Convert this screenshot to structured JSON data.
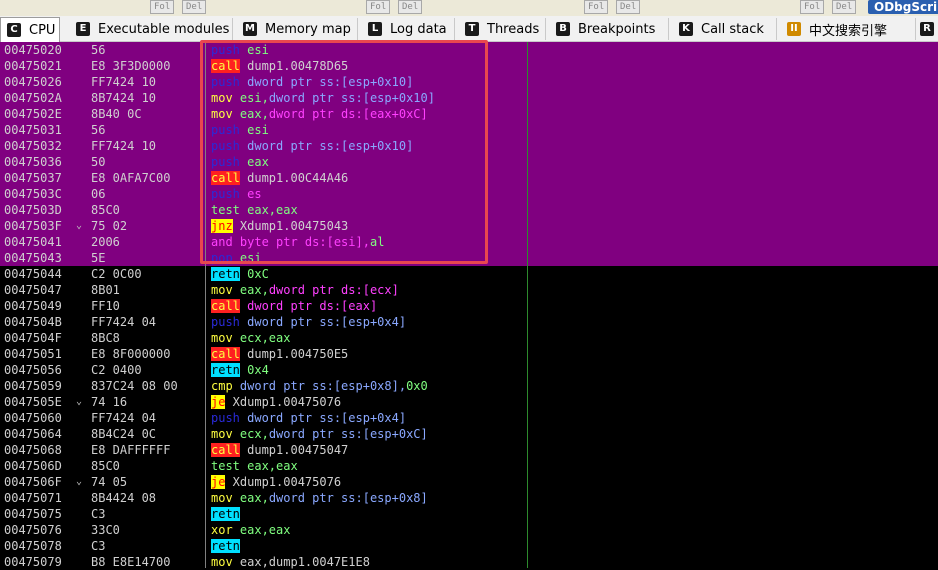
{
  "topstrip": {
    "buttons": [
      "Fol",
      "Del",
      "Fol",
      "Del",
      "Fol",
      "Del",
      "Fol",
      "Del"
    ],
    "plugin_button": "ODbgScri"
  },
  "tabs": [
    {
      "label": "CPU",
      "icon": "C",
      "color": "#1a1a1a"
    },
    {
      "label": "Executable modules",
      "icon": "E",
      "color": "#1a1a1a"
    },
    {
      "label": "Memory map",
      "icon": "M",
      "color": "#1a1a1a"
    },
    {
      "label": "Log data",
      "icon": "L",
      "color": "#1a1a1a"
    },
    {
      "label": "Threads",
      "icon": "T",
      "color": "#1a1a1a"
    },
    {
      "label": "Breakpoints",
      "icon": "B",
      "color": "#1a1a1a"
    },
    {
      "label": "Call stack",
      "icon": "K",
      "color": "#1a1a1a"
    },
    {
      "label": "中文搜索引擎",
      "icon": "II",
      "color": "#d08a00"
    },
    {
      "label": "R",
      "icon": "",
      "color": ""
    }
  ],
  "rows": [
    {
      "addr": "00475020",
      "mark": "",
      "hex": "56",
      "hl": true,
      "asm": [
        [
          "push",
          "kw-push"
        ],
        [
          " esi",
          "reg"
        ]
      ]
    },
    {
      "addr": "00475021",
      "mark": "",
      "hex": "E8 3F3D0000",
      "hl": true,
      "asm": [
        [
          "call",
          "kw-call"
        ],
        [
          " dump1.00478D65",
          "sym"
        ]
      ]
    },
    {
      "addr": "00475026",
      "mark": "",
      "hex": "FF7424 10",
      "hl": true,
      "asm": [
        [
          "push",
          "kw-push"
        ],
        [
          " dword ptr ss:[esp+0x10]",
          "mem"
        ]
      ]
    },
    {
      "addr": "0047502A",
      "mark": "",
      "hex": "8B7424 10",
      "hl": true,
      "asm": [
        [
          "mov",
          "kw-mov"
        ],
        [
          " esi,",
          "reg"
        ],
        [
          "dword ptr ss:[esp+0x10]",
          "mem"
        ]
      ]
    },
    {
      "addr": "0047502E",
      "mark": "",
      "hex": "8B40 0C",
      "hl": true,
      "asm": [
        [
          "mov",
          "kw-mov"
        ],
        [
          " eax,",
          "reg"
        ],
        [
          "dword ptr ds:[eax+0xC]",
          "memA"
        ]
      ]
    },
    {
      "addr": "00475031",
      "mark": "",
      "hex": "56",
      "hl": true,
      "asm": [
        [
          "push",
          "kw-push"
        ],
        [
          " esi",
          "reg"
        ]
      ]
    },
    {
      "addr": "00475032",
      "mark": "",
      "hex": "FF7424 10",
      "hl": true,
      "asm": [
        [
          "push",
          "kw-push"
        ],
        [
          " dword ptr ss:[esp+0x10]",
          "mem"
        ]
      ]
    },
    {
      "addr": "00475036",
      "mark": "",
      "hex": "50",
      "hl": true,
      "asm": [
        [
          "push",
          "kw-push"
        ],
        [
          " eax",
          "reg"
        ]
      ]
    },
    {
      "addr": "00475037",
      "mark": "",
      "hex": "E8 0AFA7C00",
      "hl": true,
      "asm": [
        [
          "call",
          "kw-call"
        ],
        [
          " dump1.00C44A46",
          "sym"
        ]
      ]
    },
    {
      "addr": "0047503C",
      "mark": "",
      "hex": "06",
      "hl": true,
      "asm": [
        [
          "push",
          "kw-push"
        ],
        [
          " es",
          "seg"
        ]
      ]
    },
    {
      "addr": "0047503D",
      "mark": "",
      "hex": "85C0",
      "hl": true,
      "asm": [
        [
          "test",
          "kw-test"
        ],
        [
          " eax,eax",
          "reg"
        ]
      ]
    },
    {
      "addr": "0047503F",
      "mark": "⌄",
      "hex": "75 02",
      "hl": true,
      "asm": [
        [
          "jnz",
          "kw-jcc"
        ],
        [
          " Xdump1.00475043",
          "sym"
        ]
      ]
    },
    {
      "addr": "00475041",
      "mark": "",
      "hex": "2006",
      "hl": true,
      "asm": [
        [
          "and",
          "kw-and"
        ],
        [
          " byte ptr ds:[esi],",
          "memA"
        ],
        [
          "al",
          "reg"
        ]
      ]
    },
    {
      "addr": "00475043",
      "mark": "",
      "hex": "5E",
      "hl": true,
      "asm": [
        [
          "pop",
          "kw-push"
        ],
        [
          " esi",
          "reg"
        ]
      ]
    },
    {
      "addr": "00475044",
      "mark": "",
      "hex": "C2 0C00",
      "hl": false,
      "asm": [
        [
          "retn",
          "kw-retn"
        ],
        [
          " 0xC",
          "num"
        ]
      ]
    },
    {
      "addr": "00475047",
      "mark": "",
      "hex": "8B01",
      "hl": false,
      "asm": [
        [
          "mov",
          "kw-mov"
        ],
        [
          " eax,",
          "reg"
        ],
        [
          "dword ptr ds:[ecx]",
          "memA"
        ]
      ]
    },
    {
      "addr": "00475049",
      "mark": "",
      "hex": "FF10",
      "hl": false,
      "asm": [
        [
          "call",
          "kw-call"
        ],
        [
          " dword ptr ds:[eax]",
          "memA"
        ]
      ]
    },
    {
      "addr": "0047504B",
      "mark": "",
      "hex": "FF7424 04",
      "hl": false,
      "asm": [
        [
          "push",
          "kw-push"
        ],
        [
          " dword ptr ss:[esp+0x4]",
          "mem"
        ]
      ]
    },
    {
      "addr": "0047504F",
      "mark": "",
      "hex": "8BC8",
      "hl": false,
      "asm": [
        [
          "mov",
          "kw-mov"
        ],
        [
          " ecx,eax",
          "reg"
        ]
      ]
    },
    {
      "addr": "00475051",
      "mark": "",
      "hex": "E8 8F000000",
      "hl": false,
      "asm": [
        [
          "call",
          "kw-call"
        ],
        [
          " dump1.004750E5",
          "sym"
        ]
      ]
    },
    {
      "addr": "00475056",
      "mark": "",
      "hex": "C2 0400",
      "hl": false,
      "asm": [
        [
          "retn",
          "kw-retn"
        ],
        [
          " 0x4",
          "num"
        ]
      ]
    },
    {
      "addr": "00475059",
      "mark": "",
      "hex": "837C24 08 00",
      "hl": false,
      "asm": [
        [
          "cmp",
          "kw-cmp"
        ],
        [
          " dword ptr ss:[esp+0x8],",
          "mem"
        ],
        [
          "0x0",
          "num"
        ]
      ]
    },
    {
      "addr": "0047505E",
      "mark": "⌄",
      "hex": "74 16",
      "hl": false,
      "asm": [
        [
          "je",
          "kw-jcc"
        ],
        [
          " Xdump1.00475076",
          "sym"
        ]
      ]
    },
    {
      "addr": "00475060",
      "mark": "",
      "hex": "FF7424 04",
      "hl": false,
      "asm": [
        [
          "push",
          "kw-push"
        ],
        [
          " dword ptr ss:[esp+0x4]",
          "mem"
        ]
      ]
    },
    {
      "addr": "00475064",
      "mark": "",
      "hex": "8B4C24 0C",
      "hl": false,
      "asm": [
        [
          "mov",
          "kw-mov"
        ],
        [
          " ecx,",
          "reg"
        ],
        [
          "dword ptr ss:[esp+0xC]",
          "mem"
        ]
      ]
    },
    {
      "addr": "00475068",
      "mark": "",
      "hex": "E8 DAFFFFFF",
      "hl": false,
      "asm": [
        [
          "call",
          "kw-call"
        ],
        [
          " dump1.00475047",
          "sym"
        ]
      ]
    },
    {
      "addr": "0047506D",
      "mark": "",
      "hex": "85C0",
      "hl": false,
      "asm": [
        [
          "test",
          "kw-test"
        ],
        [
          " eax,eax",
          "reg"
        ]
      ]
    },
    {
      "addr": "0047506F",
      "mark": "⌄",
      "hex": "74 05",
      "hl": false,
      "asm": [
        [
          "je",
          "kw-jcc"
        ],
        [
          " Xdump1.00475076",
          "sym"
        ]
      ]
    },
    {
      "addr": "00475071",
      "mark": "",
      "hex": "8B4424 08",
      "hl": false,
      "asm": [
        [
          "mov",
          "kw-mov"
        ],
        [
          " eax,",
          "reg"
        ],
        [
          "dword ptr ss:[esp+0x8]",
          "mem"
        ]
      ]
    },
    {
      "addr": "00475075",
      "mark": "",
      "hex": "C3",
      "hl": false,
      "asm": [
        [
          "retn",
          "kw-retn"
        ]
      ]
    },
    {
      "addr": "00475076",
      "mark": "",
      "hex": "33C0",
      "hl": false,
      "asm": [
        [
          "xor",
          "kw-xor"
        ],
        [
          " eax,eax",
          "reg"
        ]
      ]
    },
    {
      "addr": "00475078",
      "mark": "",
      "hex": "C3",
      "hl": false,
      "asm": [
        [
          "retn",
          "kw-retn"
        ]
      ]
    },
    {
      "addr": "00475079",
      "mark": "",
      "hex": "B8 E8E14700",
      "hl": false,
      "asm": [
        [
          "mov",
          "kw-mov"
        ],
        [
          " eax,dump1.0047E1E8",
          "sym"
        ]
      ]
    }
  ]
}
